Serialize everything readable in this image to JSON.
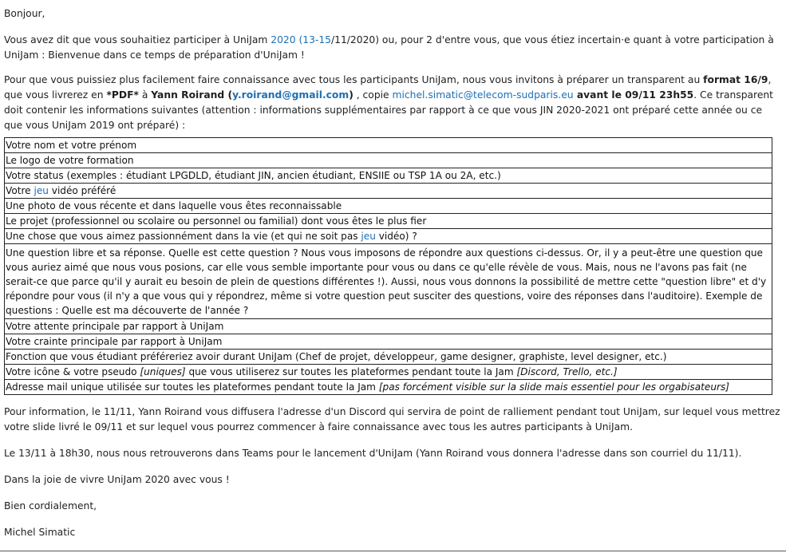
{
  "email": {
    "greeting": "Bonjour,",
    "intro": {
      "part1": "Vous avez dit que vous souhaitiez participer à UniJam ",
      "date_link": "2020 (13-15",
      "part2": "/11/2020) ou, pour 2 d'entre vous, que vous étiez incertain·e quant à votre participation à UniJam : Bienvenue dans ce temps de préparation d'UniJam !"
    },
    "instructions": {
      "t1": "Pour que vous puissiez plus facilement faire connaissance avec tous les participants UniJam, nous vous invitons à préparer un transparent au ",
      "format": "format 16/9",
      "t2": ", que vous livrerez en ",
      "pdf": "*PDF*",
      "t3": " à ",
      "name": "Yann Roirand (",
      "email1": "y.roirand@gmail.com",
      "name_close": ")",
      "t4": " , copie ",
      "email2": "michel.simatic@telecom-sudparis.eu",
      "deadline": " avant le 09/11 23h55",
      "t5": ". Ce transparent doit contenir les informations suivantes (attention : informations supplémentaires par rapport à ce que vous JIN 2020-2021 ont préparé cette année ou ce que vous UniJam 2019 ont préparé) :"
    },
    "items": {
      "r1": "Votre nom et votre prénom",
      "r2": "Le logo de votre formation",
      "r3": "Votre status (exemples : étudiant LPGDLD, étudiant JIN, ancien étudiant, ENSIIE ou TSP 1A ou 2A, etc.)",
      "r4a": "Votre ",
      "r4link": "jeu",
      "r4b": " vidéo préféré",
      "r5": "Une photo de vous récente et dans laquelle vous êtes reconnaissable",
      "r6": "Le projet (professionnel ou scolaire ou personnel ou familial) dont vous êtes le plus fier",
      "r7a": "Une chose que vous aimez passionnément dans la vie (et qui ne soit pas ",
      "r7link": "jeu",
      "r7b": " vidéo) ?",
      "r8": "Une question libre et sa réponse. Quelle est cette question ? Nous vous imposons de répondre aux questions ci-dessus. Or, il y a peut-être une question que vous auriez aimé que nous vous posions, car elle vous semble importante pour vous ou dans ce qu'elle révèle de vous. Mais, nous ne l'avons pas fait (ne serait-ce que parce qu'il y aurait eu besoin de plein de questions différentes !). Aussi, nous vous donnons la possibilité de mettre cette \"question libre\" et d'y répondre pour vous (il n'y a que vous qui y répondrez, même si votre question peut susciter des questions, voire des réponses dans l'auditoire). Exemple de questions : Quelle est ma découverte de l'année ?",
      "r9": "Votre attente principale par rapport à UniJam",
      "r10": "Votre crainte principale par rapport à UniJam",
      "r11": "Fonction que vous étudiant préféreriez avoir durant UniJam (Chef de projet, développeur, game designer, graphiste, level designer, etc.)",
      "r12a": "Votre icône & votre pseudo ",
      "r12it1": "[uniques]",
      "r12b": " que vous utiliserez sur toutes les plateformes pendant toute la Jam ",
      "r12it2": "[Discord, Trello, etc.]",
      "r13a": "Adresse mail unique utilisée sur toutes les plateformes pendant toute la Jam ",
      "r13it": "[pas forcément visible sur la slide mais essentiel pour les orgabisateurs]"
    },
    "discord_info": "Pour information, le 11/11, Yann Roirand vous diffusera l'adresse d'un Discord qui servira de point de ralliement pendant tout UniJam, sur lequel vous mettrez votre slide livré le 09/11 et sur lequel vous pourrez commencer à faire connaissance avec tous les autres participants à UniJam.",
    "teams_info": "Le 13/11 à 18h30, nous nous retrouverons dans Teams pour le lancement d'UniJam (Yann Roirand vous donnera l'adresse dans son courriel du 11/11).",
    "closing_joy": "Dans la joie de vivre UniJam 2020 avec vous !",
    "sign_off": "Bien cordialement,",
    "signature": "Michel Simatic"
  },
  "colors": {
    "link": "#1e6fb4",
    "text": "#1f1f1f"
  }
}
